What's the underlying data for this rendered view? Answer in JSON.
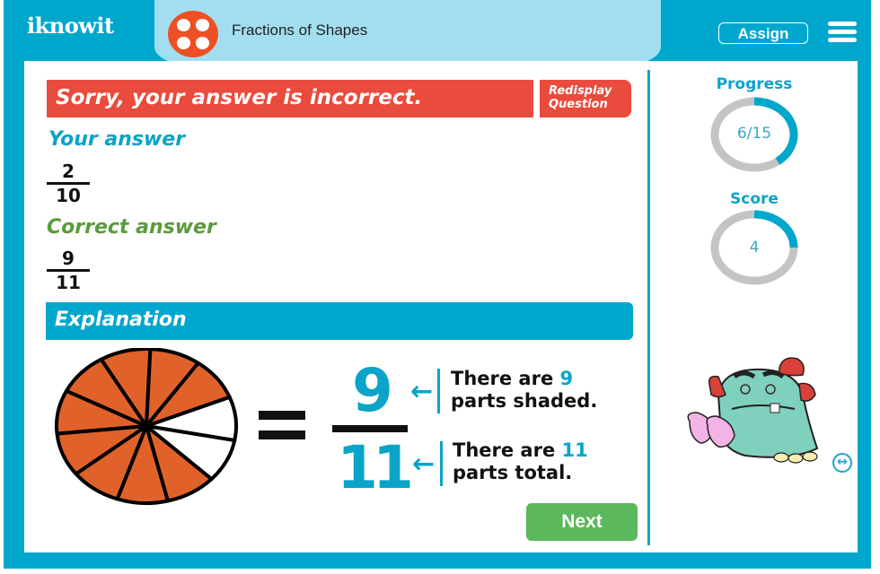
{
  "header": {
    "logo_text": "iknowit",
    "topic_icon": "dice-four-dots-icon",
    "topic_title": "Fractions of Shapes",
    "assign_label": "Assign",
    "menu_icon": "hamburger-menu-icon"
  },
  "feedback": {
    "message": "Sorry, your answer is incorrect.",
    "redisplay_line1": "Redisplay",
    "redisplay_line2": "Question",
    "banner_color": "#e94b3c"
  },
  "your_answer": {
    "label": "Your answer",
    "numerator": "2",
    "denominator": "10"
  },
  "correct_answer": {
    "label": "Correct answer",
    "numerator": "9",
    "denominator": "11"
  },
  "explanation": {
    "title": "Explanation",
    "circle": {
      "total_parts": 11,
      "shaded_parts": 9,
      "shaded_color": "#e0622a"
    },
    "equals_sign": "=",
    "numerator": "9",
    "denominator": "11",
    "arrow_glyph": "←",
    "note_top_prefix": "There are ",
    "note_top_value": "9",
    "note_top_suffix": "parts shaded.",
    "note_bottom_prefix": "There are ",
    "note_bottom_value": "11",
    "note_bottom_suffix": "parts total."
  },
  "next_label": "Next",
  "sidebar": {
    "progress_label": "Progress",
    "progress_text": "6/15",
    "progress_fraction": 0.4,
    "score_label": "Score",
    "score_text": "4",
    "score_fraction": 0.25,
    "accent_color": "#00a7cd",
    "track_color": "#c4c4c4",
    "mascot": "monster-mascot-with-slippers",
    "resize_glyph": "↔"
  }
}
